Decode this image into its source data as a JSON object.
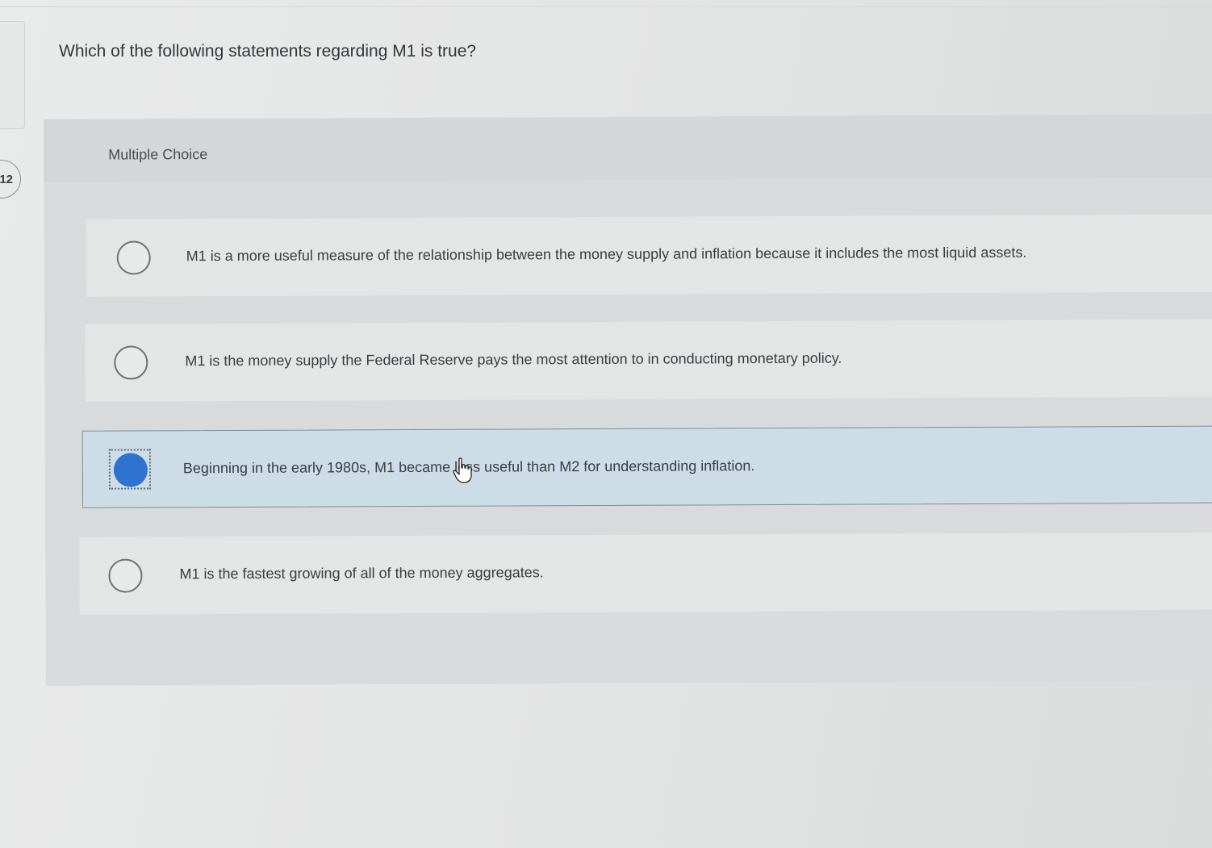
{
  "question": {
    "number": "12",
    "text": "Which of the following statements regarding M1 is true?"
  },
  "choices": {
    "label": "Multiple Choice",
    "options": [
      {
        "text": "M1 is a more useful measure of the relationship between the money supply and inflation because it includes the most liquid assets.",
        "selected": false
      },
      {
        "text": "M1 is the money supply the Federal Reserve pays the most attention to in conducting monetary policy.",
        "selected": false
      },
      {
        "text": "Beginning in the early 1980s, M1 became less useful than M2 for understanding inflation.",
        "selected": true
      },
      {
        "text": "M1 is the fastest growing of all of the money aggregates.",
        "selected": false
      }
    ]
  },
  "colors": {
    "selected_radio": "#2d73cf",
    "selected_option_bg": "#ccdde7"
  },
  "icons": {
    "cursor": "hand-pointer-icon"
  }
}
